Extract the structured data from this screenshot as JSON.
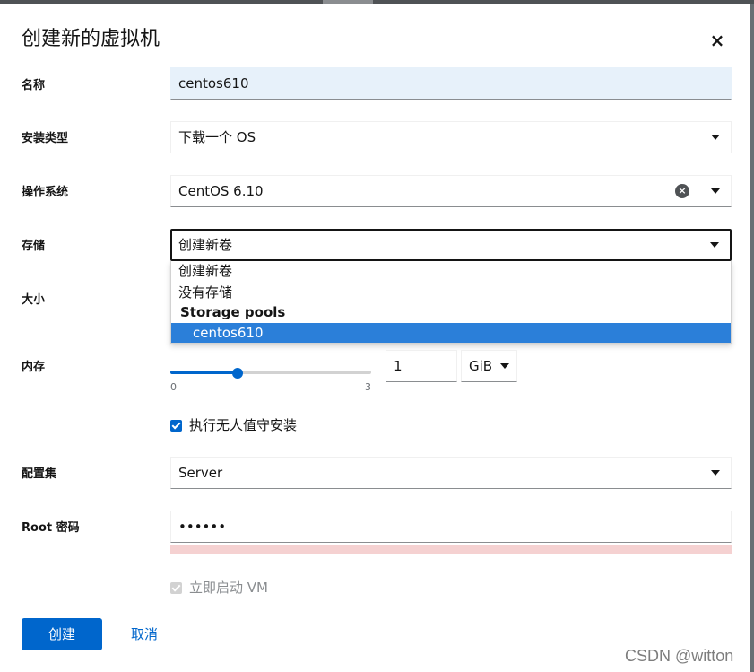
{
  "dialog": {
    "title": "创建新的虚拟机",
    "close_icon": "×"
  },
  "form": {
    "name": {
      "label": "名称",
      "value": "centos610"
    },
    "install_type": {
      "label": "安装类型",
      "value": "下载一个 OS"
    },
    "os": {
      "label": "操作系统",
      "value": "CentOS 6.10",
      "clear_icon": "×"
    },
    "storage": {
      "label": "存储",
      "value": "创建新卷",
      "options": {
        "create_new": "创建新卷",
        "no_storage": "没有存储",
        "group_label": "Storage pools",
        "pool_selected": "centos610"
      }
    },
    "size": {
      "label": "大小"
    },
    "memory": {
      "label": "内存",
      "slider_value": 1,
      "slider_min": 0,
      "slider_max": 3,
      "min_label": "0",
      "max_label": "3",
      "value": "1",
      "unit": "GiB"
    },
    "unattended": {
      "label": "执行无人值守安装",
      "checked": true
    },
    "profile": {
      "label": "配置集",
      "value": "Server"
    },
    "root_password": {
      "label": "Root 密码",
      "value": "••••••"
    },
    "start_vm": {
      "label": "立即启动 VM",
      "checked": true,
      "disabled": true
    }
  },
  "actions": {
    "create": "创建",
    "cancel": "取消"
  },
  "watermark": "CSDN @witton",
  "colors": {
    "primary": "#0066cc",
    "selected_option": "#2b7fd9",
    "name_field_bg": "#e7f1fa",
    "error_bar": "#f5d1d1"
  }
}
